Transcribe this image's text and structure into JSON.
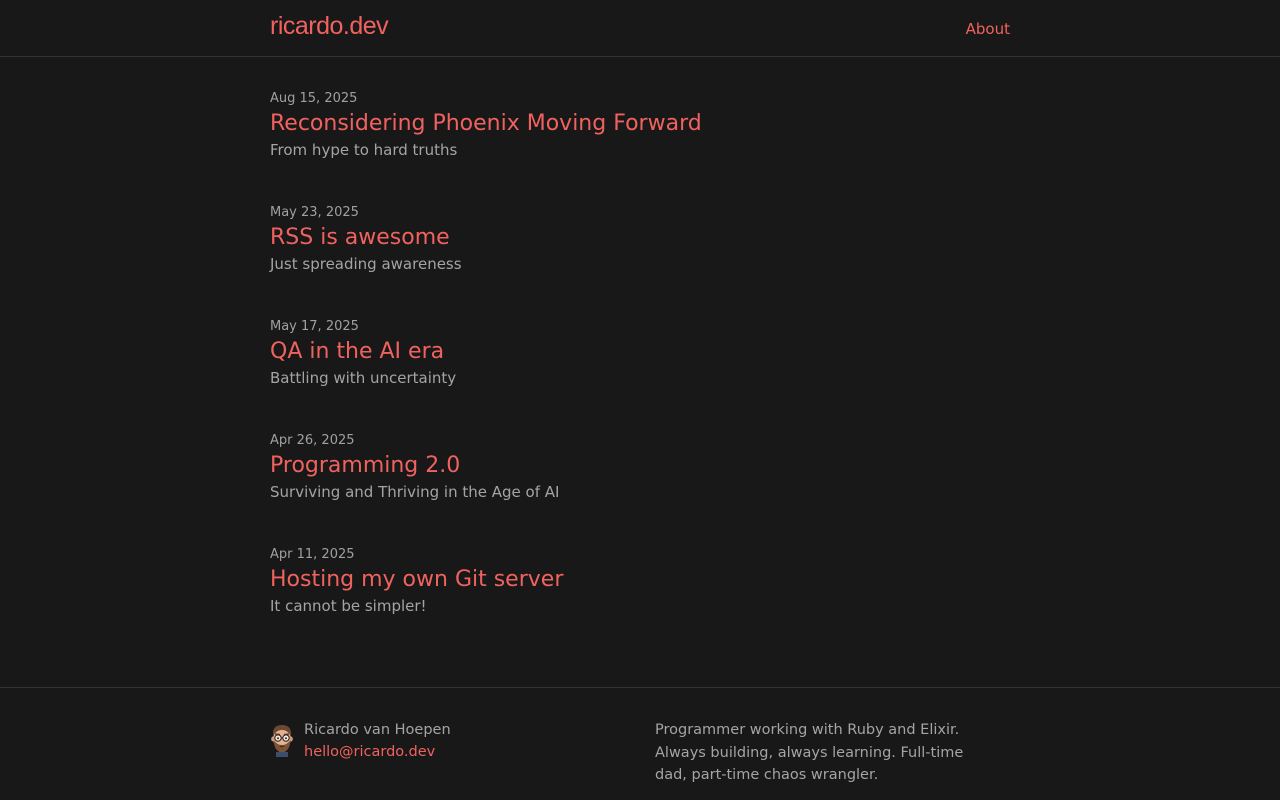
{
  "site": {
    "title": "ricardo.dev",
    "nav": [
      {
        "label": "About"
      }
    ]
  },
  "posts": [
    {
      "date": "Aug 15, 2025",
      "title": "Reconsidering Phoenix Moving Forward",
      "subtitle": "From hype to hard truths"
    },
    {
      "date": "May 23, 2025",
      "title": "RSS is awesome",
      "subtitle": "Just spreading awareness"
    },
    {
      "date": "May 17, 2025",
      "title": "QA in the AI era",
      "subtitle": "Battling with uncertainty"
    },
    {
      "date": "Apr 26, 2025",
      "title": "Programming 2.0",
      "subtitle": "Surviving and Thriving in the Age of AI"
    },
    {
      "date": "Apr 11, 2025",
      "title": "Hosting my own Git server",
      "subtitle": "It cannot be simpler!"
    }
  ],
  "footer": {
    "author_name": "Ricardo van Hoepen",
    "email": "hello@ricardo.dev",
    "bio": "Programmer working with Ruby and Elixir. Always building, always learning. Full-time dad, part-time chaos wrangler.",
    "avatar_icon": "cartoon-avatar-icon"
  },
  "colors": {
    "background": "#181818",
    "accent": "#f0625f",
    "text_muted": "#a4a4a4",
    "border": "#333333"
  }
}
